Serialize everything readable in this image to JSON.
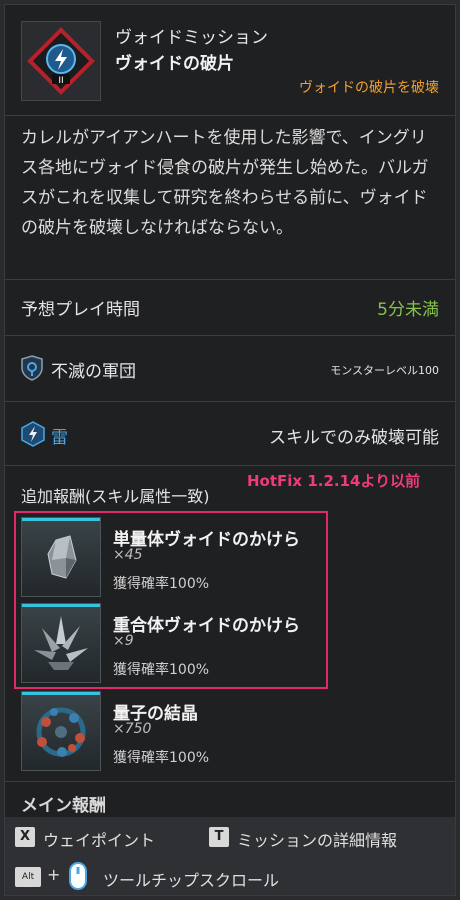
{
  "header": {
    "subtitle": "ヴォイドミッション",
    "title": "ヴォイドの破片",
    "objective": "ヴォイドの破片を破壊",
    "mission_icon": "void-mission-icon"
  },
  "description": "カレルがアイアンハートを使用した影響で、イングリス各地にヴォイド侵食の破片が発生し始めた。バルガスがこれを収集して研究を終わらせる前に、ヴォイドの破片を破壊しなければならない。",
  "play_time": {
    "label": "予想プレイ時間",
    "value": "5分未満"
  },
  "faction": {
    "label": "不滅の軍団",
    "value": "モンスターレベル100"
  },
  "element": {
    "label": "雷",
    "value": "スキルでのみ破壊可能"
  },
  "rewards": {
    "title": "追加報酬(スキル属性一致)",
    "annotation": "HotFix 1.2.14より以前",
    "items": [
      {
        "name": "単量体ヴォイドのかけら",
        "qty": "×45",
        "rate": "獲得確率100%"
      },
      {
        "name": "重合体ヴォイドのかけら",
        "qty": "×9",
        "rate": "獲得確率100%"
      },
      {
        "name": "量子の結晶",
        "qty": "×750",
        "rate": "獲得確率100%"
      }
    ]
  },
  "next_section_cut": "メイン報酬",
  "footer": {
    "waypoint_key": "X",
    "waypoint_label": "ウェイポイント",
    "details_key": "T",
    "details_label": "ミッションの詳細情報",
    "alt_key": "Alt",
    "plus": "+",
    "scroll_label": "ツールチップスクロール"
  },
  "colors": {
    "objective": "#f0a030",
    "green": "#86c34a",
    "blue": "#4aa6e8",
    "highlight": "#e0286f",
    "accent": "#35c4e0"
  }
}
